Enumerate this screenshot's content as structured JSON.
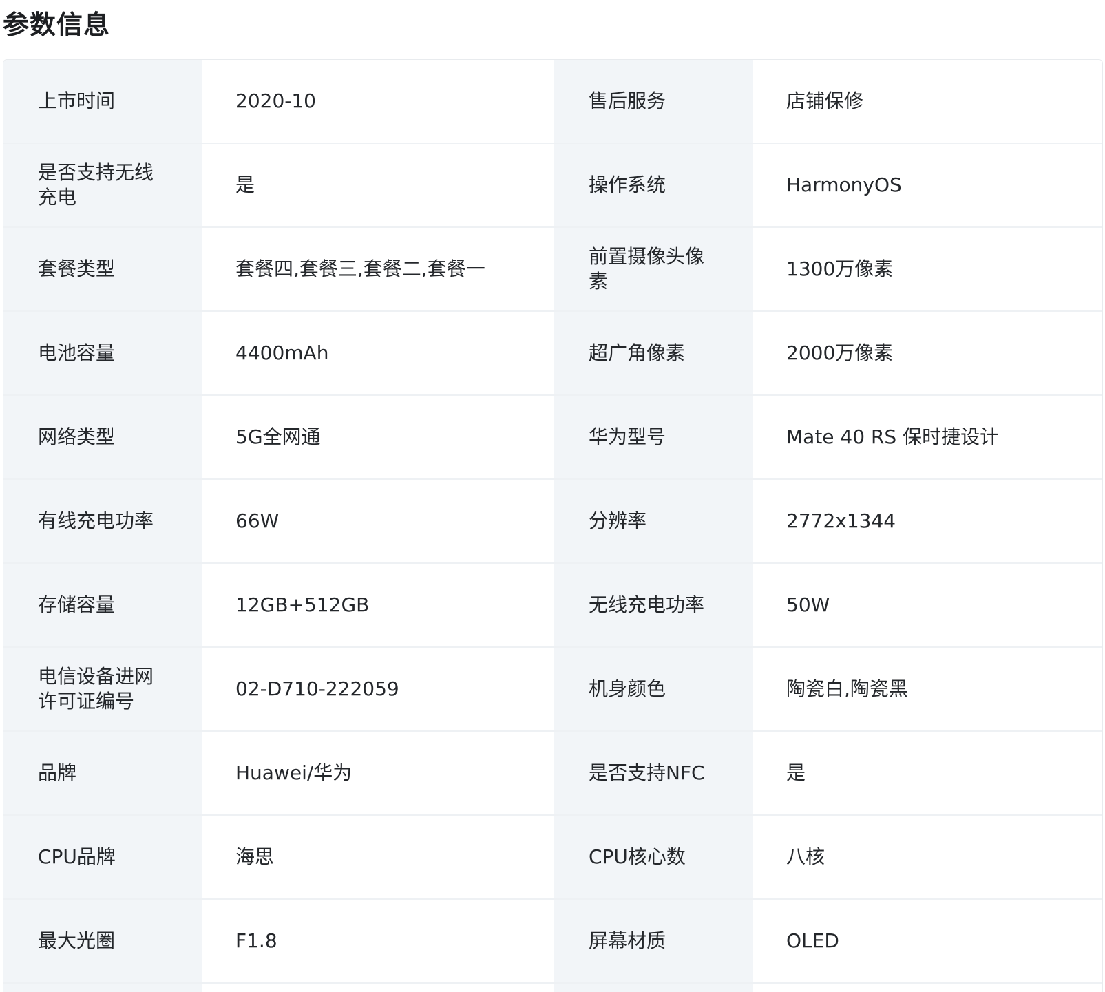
{
  "page": {
    "title": "参数信息"
  },
  "specs": [
    {
      "label_left": "上市时间",
      "value_left": "2020-10",
      "label_right": "售后服务",
      "value_right": "店铺保修"
    },
    {
      "label_left": "是否支持无线充电",
      "value_left": "是",
      "label_right": "操作系统",
      "value_right": "HarmonyOS"
    },
    {
      "label_left": "套餐类型",
      "value_left": "套餐四,套餐三,套餐二,套餐一",
      "label_right": "前置摄像头像素",
      "value_right": "1300万像素"
    },
    {
      "label_left": "电池容量",
      "value_left": "4400mAh",
      "label_right": "超广角像素",
      "value_right": "2000万像素"
    },
    {
      "label_left": "网络类型",
      "value_left": "5G全网通",
      "label_right": "华为型号",
      "value_right": "Mate 40 RS 保时捷设计"
    },
    {
      "label_left": "有线充电功率",
      "value_left": "66W",
      "label_right": "分辨率",
      "value_right": "2772x1344"
    },
    {
      "label_left": "存储容量",
      "value_left": "12GB+512GB",
      "label_right": "无线充电功率",
      "value_right": "50W"
    },
    {
      "label_left": "电信设备进网许可证编号",
      "value_left": "02-D710-222059",
      "label_right": "机身颜色",
      "value_right": "陶瓷白,陶瓷黑"
    },
    {
      "label_left": "品牌",
      "value_left": "Huawei/华为",
      "label_right": "是否支持NFC",
      "value_right": "是"
    },
    {
      "label_left": "CPU品牌",
      "value_left": "海思",
      "label_right": "CPU核心数",
      "value_right": "八核"
    },
    {
      "label_left": "最大光圈",
      "value_left": "F1.8",
      "label_right": "屏幕材质",
      "value_right": "OLED"
    }
  ]
}
